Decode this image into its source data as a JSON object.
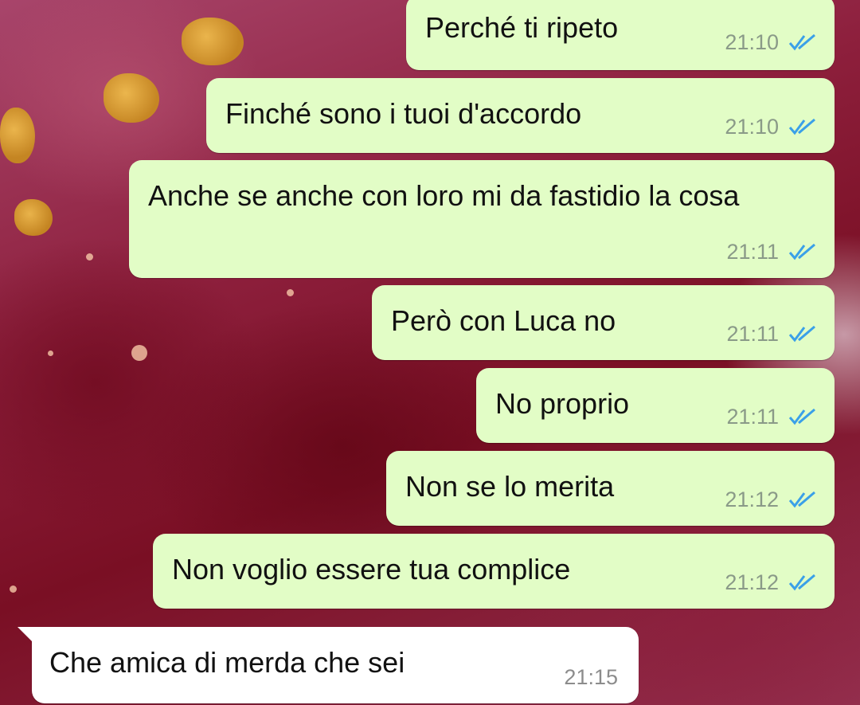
{
  "chat": {
    "messages": [
      {
        "direction": "outgoing",
        "text": "Perché ti ripeto",
        "time": "21:10",
        "status": "read"
      },
      {
        "direction": "outgoing",
        "text": "Finché sono i tuoi d'accordo",
        "time": "21:10",
        "status": "read"
      },
      {
        "direction": "outgoing",
        "text": "Anche se anche con loro mi da fastidio la cosa",
        "time": "21:11",
        "status": "read"
      },
      {
        "direction": "outgoing",
        "text": "Però con Luca no",
        "time": "21:11",
        "status": "read"
      },
      {
        "direction": "outgoing",
        "text": "No proprio",
        "time": "21:11",
        "status": "read"
      },
      {
        "direction": "outgoing",
        "text": "Non se lo merita",
        "time": "21:12",
        "status": "read"
      },
      {
        "direction": "outgoing",
        "text": "Non voglio essere tua complice",
        "time": "21:12",
        "status": "read"
      },
      {
        "direction": "incoming",
        "text": "Che amica di merda che sei",
        "time": "21:15"
      }
    ]
  },
  "colors": {
    "outgoing_bubble": "#e2fdc6",
    "incoming_bubble": "#ffffff",
    "read_ticks": "#3aa0e8",
    "wallpaper": "#8d1f3c"
  },
  "icons": {
    "read_status": "double-check-icon"
  }
}
